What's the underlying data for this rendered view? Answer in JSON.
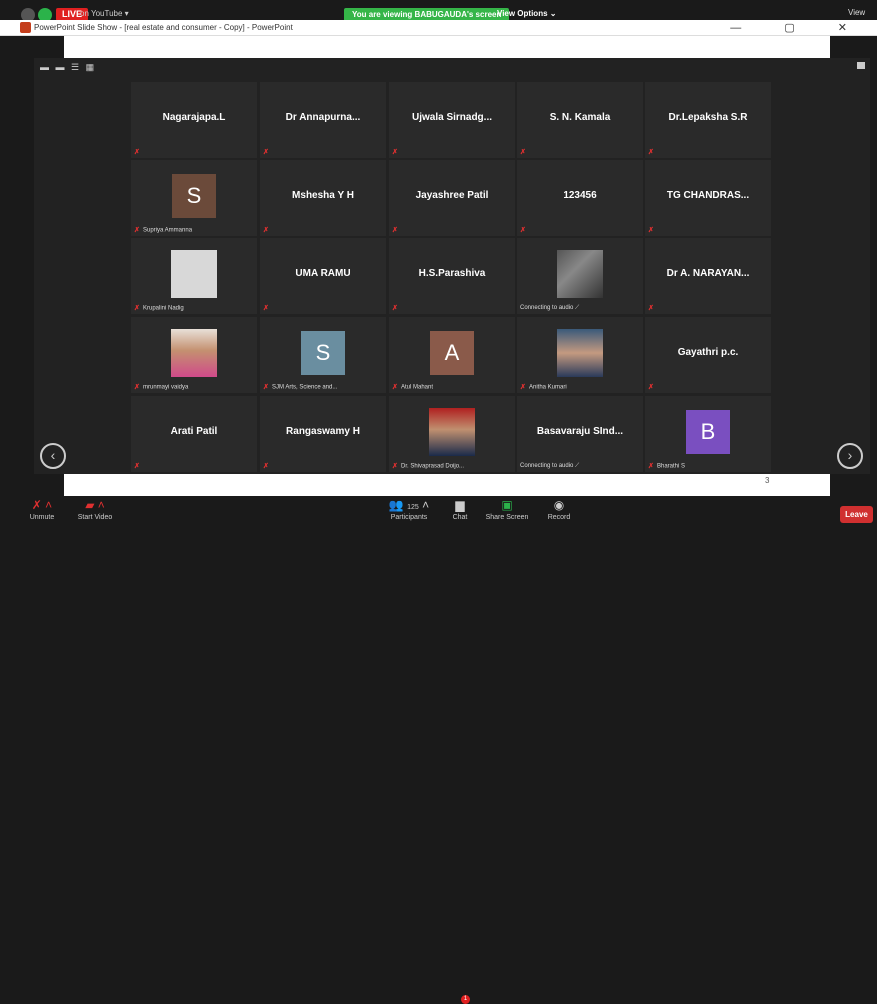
{
  "meeting": {
    "live_label": "LIVE",
    "youtube_label": "on YouTube ▾",
    "sharing_banner": "You are viewing BABUGAUDA's screen",
    "view_options": "View Options ⌄",
    "view_right": "View"
  },
  "powerpoint": {
    "title": "PowerPoint Slide Show - [real estate and consumer - Copy] - PowerPoint",
    "controls": "— ▢ ✕",
    "slide_number": "3"
  },
  "gallery": {
    "layout_icons": "▬ ▬ ☰ ▦",
    "prev_arrow": "‹",
    "next_arrow": "›",
    "participants": [
      {
        "name": "Nagarajapa.L",
        "label": ""
      },
      {
        "name": "Dr Annapurna...",
        "label": ""
      },
      {
        "name": "Ujwala Sirnadg...",
        "label": ""
      },
      {
        "name": "S. N. Kamala",
        "label": ""
      },
      {
        "name": "Dr.Lepaksha S.R",
        "label": ""
      },
      {
        "name": "S",
        "label": "Supriya Ammanna",
        "avatar_color": "#6b4a3a"
      },
      {
        "name": "Mshesha Y H",
        "label": ""
      },
      {
        "name": "Jayashree Patil",
        "label": ""
      },
      {
        "name": "123456",
        "label": ""
      },
      {
        "name": "TG  CHANDRAS...",
        "label": ""
      },
      {
        "name": "",
        "label": "Krupalini Nadig",
        "avatar": "silhouette"
      },
      {
        "name": "UMA RAMU",
        "label": ""
      },
      {
        "name": "H.S.Parashiva",
        "label": ""
      },
      {
        "name": "",
        "label": "Connecting to audio ⟋",
        "avatar": "photo-couple"
      },
      {
        "name": "Dr A. NARAYAN...",
        "label": ""
      },
      {
        "name": "",
        "label": "mrunmayi vaidya",
        "avatar": "photo-woman-pink"
      },
      {
        "name": "S",
        "label": "SJM Arts, Science and...",
        "avatar_color": "#6a8ea0"
      },
      {
        "name": "A",
        "label": "Atul Mahant",
        "avatar_color": "#8a5a4a"
      },
      {
        "name": "",
        "label": "Anitha Kumari",
        "avatar": "photo-woman-blue"
      },
      {
        "name": "Gayathri p.c.",
        "label": ""
      },
      {
        "name": "Arati Patil",
        "label": ""
      },
      {
        "name": "Rangaswamy H",
        "label": ""
      },
      {
        "name": "",
        "label": "Dr. Shivaprasad Doijo...",
        "avatar": "photo-man-suit"
      },
      {
        "name": "Basavaraju  SInd...",
        "label": "Connecting to audio ⟋"
      },
      {
        "name": "B",
        "label": "Bharathi S",
        "avatar_color": "#7a4fc0"
      }
    ]
  },
  "toolbar": {
    "unmute": "Unmute",
    "start_video": "Start Video",
    "participants": "Participants",
    "participants_count": "125",
    "chat": "Chat",
    "chat_badge": "1",
    "share_screen": "Share Screen",
    "record": "Record",
    "leave": "Leave"
  }
}
